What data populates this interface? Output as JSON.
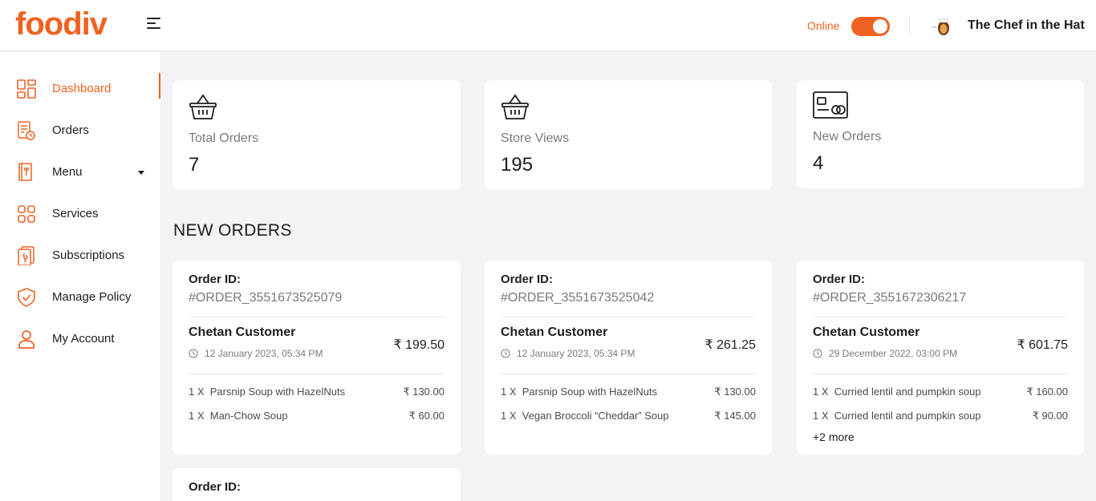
{
  "brand": {
    "logo_text": "foodiv",
    "accent": "#ef6221"
  },
  "header": {
    "menu_icon": "hamburger-icon",
    "online_label": "Online",
    "online_toggle": "on",
    "user_name": "The Chef in the Hat",
    "avatar_icon": "chef-avatar-icon"
  },
  "sidebar": {
    "items": [
      {
        "label": "Dashboard",
        "icon": "dashboard-icon",
        "active": true
      },
      {
        "label": "Orders",
        "icon": "orders-icon"
      },
      {
        "label": "Menu",
        "icon": "menu-book-icon",
        "has_dropdown": true
      },
      {
        "label": "Services",
        "icon": "services-grid-icon"
      },
      {
        "label": "Subscriptions",
        "icon": "subscriptions-icon"
      },
      {
        "label": "Manage Policy",
        "icon": "shield-check-icon"
      },
      {
        "label": "My Account",
        "icon": "user-icon"
      }
    ]
  },
  "stats": [
    {
      "label": "Total Orders",
      "value": "7",
      "icon": "basket-icon"
    },
    {
      "label": "Store Views",
      "value": "195",
      "icon": "basket-icon"
    },
    {
      "label": "New Orders",
      "value": "4",
      "icon": "card-icon"
    }
  ],
  "new_orders_title": "NEW ORDERS",
  "orders": [
    {
      "id_label": "Order ID:",
      "id": "#ORDER_3551673525079",
      "customer": "Chetan Customer",
      "date": "12 January 2023, 05:34 PM",
      "total": "₹ 199.50",
      "items": [
        {
          "qty": "1 X",
          "name": "Parsnip Soup with HazelNuts",
          "price": "₹ 130.00"
        },
        {
          "qty": "1 X",
          "name": "Man-Chow Soup",
          "price": "₹ 60.00"
        }
      ]
    },
    {
      "id_label": "Order ID:",
      "id": "#ORDER_3551673525042",
      "customer": "Chetan Customer",
      "date": "12 January 2023, 05:34 PM",
      "total": "₹ 261.25",
      "items": [
        {
          "qty": "1 X",
          "name": "Parsnip Soup with HazelNuts",
          "price": "₹ 130.00"
        },
        {
          "qty": "1 X",
          "name": "Vegan Broccoli “Cheddar” Soup",
          "price": "₹ 145.00"
        }
      ]
    },
    {
      "id_label": "Order ID:",
      "id": "#ORDER_3551672306217",
      "customer": "Chetan Customer",
      "date": "29 December 2022, 03:00 PM",
      "total": "₹ 601.75",
      "items": [
        {
          "qty": "1 X",
          "name": "Curried lentil and pumpkin soup",
          "price": "₹ 160.00"
        },
        {
          "qty": "1 X",
          "name": "Curried lentil and pumpkin soup",
          "price": "₹ 90.00"
        }
      ],
      "more": "+2 more"
    },
    {
      "id_label": "Order ID:"
    }
  ]
}
